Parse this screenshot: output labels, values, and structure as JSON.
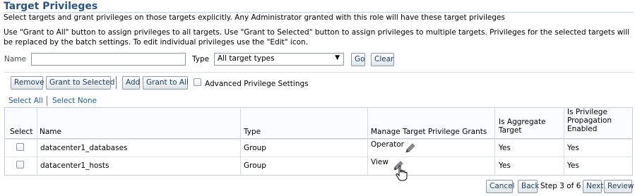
{
  "header": {
    "title": "Target Privileges",
    "description": "Select targets and grant privileges on those targets explicitly. Any Administrator granted with this role will have these target privileges",
    "instructions": "Use \"Grant to All\" button to assign privileges to all targets. Use \"Grant to Selected\" button to assign privileges to multiple targets. Privileges for the selected targets will be replaced by the batch settings. To edit individual privileges use the \"Edit\" icon."
  },
  "search": {
    "name_label": "Name",
    "name_value": "",
    "type_label": "Type",
    "type_selected": "All target types",
    "go_label": "Go",
    "clear_label": "Clear"
  },
  "toolbar": {
    "remove_label": "Remove",
    "grant_selected_label": "Grant to Selected",
    "add_label": "Add",
    "grant_all_label": "Grant to All",
    "advanced_label": "Advanced Privilege Settings",
    "advanced_checked": false
  },
  "selection": {
    "select_all": "Select All",
    "select_none": "Select None"
  },
  "table": {
    "columns": [
      "Select",
      "Name",
      "Type",
      "Manage Target Privilege Grants",
      "Is Aggregate Target",
      "Is Privilege Propagation Enabled"
    ],
    "rows": [
      {
        "name": "datacenter1_databases",
        "type": "Group",
        "grant": "Operator",
        "aggregate": "Yes",
        "propagation": "Yes"
      },
      {
        "name": "datacenter1_hosts",
        "type": "Group",
        "grant": "View",
        "aggregate": "Yes",
        "propagation": "Yes"
      }
    ]
  },
  "footer": {
    "cancel_label": "Cancel",
    "back_label": "Back",
    "step_text": "Step 3 of 6",
    "next_label": "Next",
    "review_label": "Review"
  },
  "colors": {
    "title": "#2b5580",
    "link": "#1f5a8e",
    "button_text": "#1e3c5a"
  },
  "icons": [
    "pencil-edit-icon",
    "hand-cursor-icon",
    "dropdown-arrow-icon"
  ]
}
